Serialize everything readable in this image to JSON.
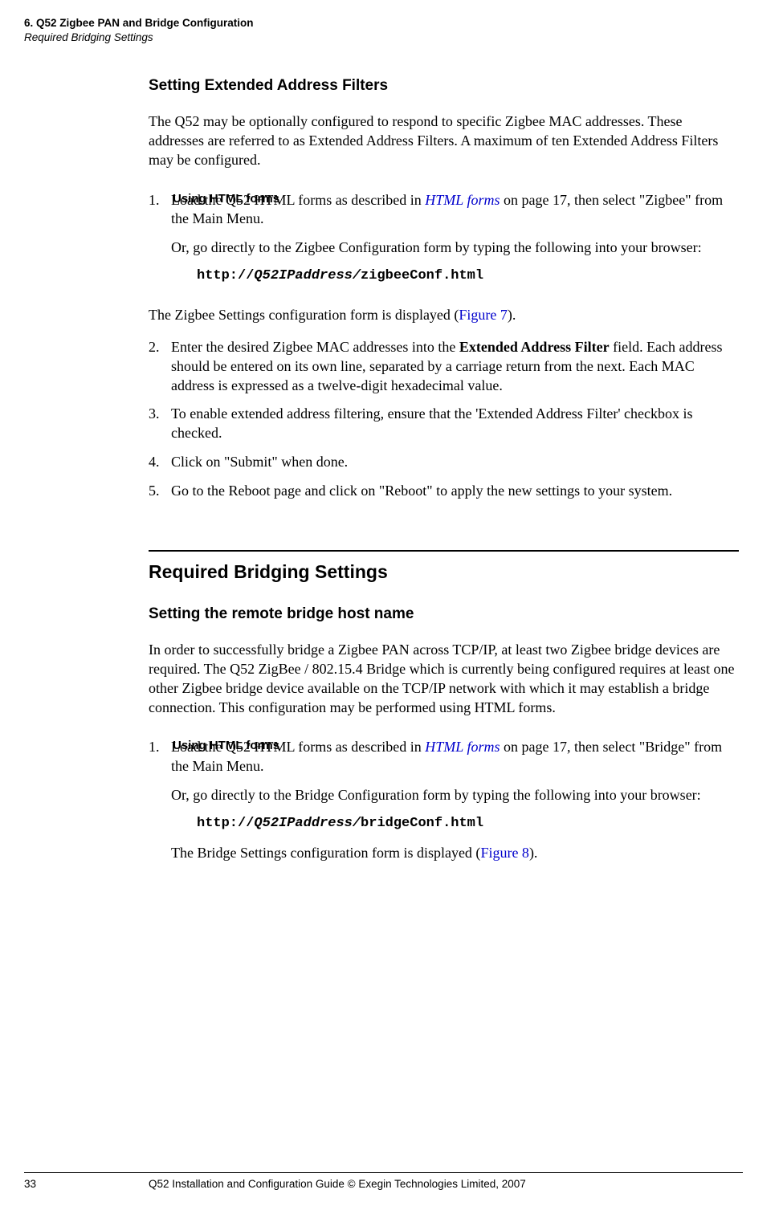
{
  "header": {
    "line1": "6. Q52 Zigbee PAN and Bridge Configuration",
    "line2": "Required Bridging Settings"
  },
  "sec1": {
    "title": "Setting Extended Address Filters",
    "intro": "The Q52 may be optionally configured to respond to specific Zigbee MAC addresses. These addresses are referred to as Extended Address Filters. A maximum of ten Extended Address Filters may be configured.",
    "sideLabel": "Using HTML forms",
    "step1_a": "Load the Q52 HTML forms as described in ",
    "step1_link": "HTML forms",
    "step1_b": " on page 17, then select \"Zigbee\" from the Main Menu.",
    "step1_or": "Or, go directly to the Zigbee Configuration form by typing the following into your browser:",
    "code_prefix": "http://",
    "code_ital": "Q52IPaddress/",
    "code_suffix": "zigbeeConf.html",
    "afterCode_a": "The Zigbee Settings configuration form is displayed (",
    "afterCode_link": "Figure 7",
    "afterCode_b": ").",
    "step2_a": "Enter the desired Zigbee MAC addresses into the ",
    "step2_bold": "Extended Address Filter",
    "step2_b": " field. Each address should be entered on its own line, separated by a carriage return from the next. Each MAC address is expressed as a twelve-digit hexadecimal value.",
    "step3": "To enable extended address filtering, ensure that the 'Extended Address Filter' checkbox is checked.",
    "step4": "Click on \"Submit\" when done.",
    "step5": "Go to the Reboot page and click on \"Reboot\" to apply the new settings to your system."
  },
  "sec2": {
    "majorTitle": "Required Bridging Settings",
    "title": "Setting the remote bridge host name",
    "intro": "In order to successfully bridge a Zigbee PAN across TCP/IP, at least two Zigbee bridge devices are required. The Q52 ZigBee / 802.15.4 Bridge which is currently being configured requires at least one other Zigbee bridge device available on the TCP/IP network with which it may establish a bridge connection. This configuration may be performed using HTML forms.",
    "sideLabel": "Using HTML forms",
    "step1_a": "Load the Q52 HTML forms as described in ",
    "step1_link": "HTML forms",
    "step1_b": " on page 17, then select \"Bridge\" from the Main Menu.",
    "step1_or": "Or, go directly to the Bridge Configuration form by typing the following into your browser:",
    "code_prefix": "http://",
    "code_ital": "Q52IPaddress/",
    "code_suffix": "bridgeConf.html",
    "afterCode_a": "The Bridge Settings configuration form is displayed (",
    "afterCode_link": "Figure 8",
    "afterCode_b": ")."
  },
  "footer": {
    "page": "33",
    "text": "Q52 Installation and Configuration Guide  © Exegin Technologies Limited, 2007"
  }
}
